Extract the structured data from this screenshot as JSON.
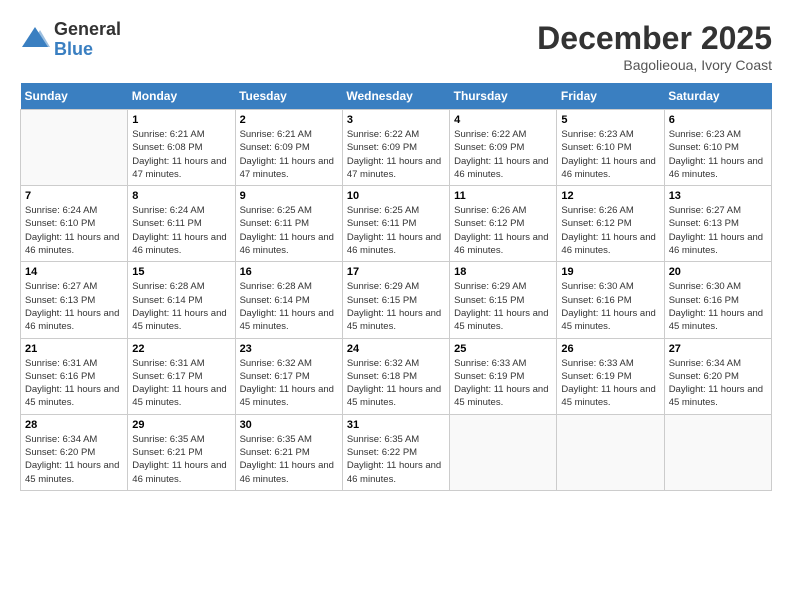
{
  "header": {
    "logo_general": "General",
    "logo_blue": "Blue",
    "month_title": "December 2025",
    "location": "Bagolieoua, Ivory Coast"
  },
  "weekdays": [
    "Sunday",
    "Monday",
    "Tuesday",
    "Wednesday",
    "Thursday",
    "Friday",
    "Saturday"
  ],
  "weeks": [
    [
      {
        "day": "",
        "empty": true
      },
      {
        "day": "1",
        "sunrise": "6:21 AM",
        "sunset": "6:08 PM",
        "daylight": "11 hours and 47 minutes."
      },
      {
        "day": "2",
        "sunrise": "6:21 AM",
        "sunset": "6:09 PM",
        "daylight": "11 hours and 47 minutes."
      },
      {
        "day": "3",
        "sunrise": "6:22 AM",
        "sunset": "6:09 PM",
        "daylight": "11 hours and 47 minutes."
      },
      {
        "day": "4",
        "sunrise": "6:22 AM",
        "sunset": "6:09 PM",
        "daylight": "11 hours and 46 minutes."
      },
      {
        "day": "5",
        "sunrise": "6:23 AM",
        "sunset": "6:10 PM",
        "daylight": "11 hours and 46 minutes."
      },
      {
        "day": "6",
        "sunrise": "6:23 AM",
        "sunset": "6:10 PM",
        "daylight": "11 hours and 46 minutes."
      }
    ],
    [
      {
        "day": "7",
        "sunrise": "6:24 AM",
        "sunset": "6:10 PM",
        "daylight": "11 hours and 46 minutes."
      },
      {
        "day": "8",
        "sunrise": "6:24 AM",
        "sunset": "6:11 PM",
        "daylight": "11 hours and 46 minutes."
      },
      {
        "day": "9",
        "sunrise": "6:25 AM",
        "sunset": "6:11 PM",
        "daylight": "11 hours and 46 minutes."
      },
      {
        "day": "10",
        "sunrise": "6:25 AM",
        "sunset": "6:11 PM",
        "daylight": "11 hours and 46 minutes."
      },
      {
        "day": "11",
        "sunrise": "6:26 AM",
        "sunset": "6:12 PM",
        "daylight": "11 hours and 46 minutes."
      },
      {
        "day": "12",
        "sunrise": "6:26 AM",
        "sunset": "6:12 PM",
        "daylight": "11 hours and 46 minutes."
      },
      {
        "day": "13",
        "sunrise": "6:27 AM",
        "sunset": "6:13 PM",
        "daylight": "11 hours and 46 minutes."
      }
    ],
    [
      {
        "day": "14",
        "sunrise": "6:27 AM",
        "sunset": "6:13 PM",
        "daylight": "11 hours and 46 minutes."
      },
      {
        "day": "15",
        "sunrise": "6:28 AM",
        "sunset": "6:14 PM",
        "daylight": "11 hours and 45 minutes."
      },
      {
        "day": "16",
        "sunrise": "6:28 AM",
        "sunset": "6:14 PM",
        "daylight": "11 hours and 45 minutes."
      },
      {
        "day": "17",
        "sunrise": "6:29 AM",
        "sunset": "6:15 PM",
        "daylight": "11 hours and 45 minutes."
      },
      {
        "day": "18",
        "sunrise": "6:29 AM",
        "sunset": "6:15 PM",
        "daylight": "11 hours and 45 minutes."
      },
      {
        "day": "19",
        "sunrise": "6:30 AM",
        "sunset": "6:16 PM",
        "daylight": "11 hours and 45 minutes."
      },
      {
        "day": "20",
        "sunrise": "6:30 AM",
        "sunset": "6:16 PM",
        "daylight": "11 hours and 45 minutes."
      }
    ],
    [
      {
        "day": "21",
        "sunrise": "6:31 AM",
        "sunset": "6:16 PM",
        "daylight": "11 hours and 45 minutes."
      },
      {
        "day": "22",
        "sunrise": "6:31 AM",
        "sunset": "6:17 PM",
        "daylight": "11 hours and 45 minutes."
      },
      {
        "day": "23",
        "sunrise": "6:32 AM",
        "sunset": "6:17 PM",
        "daylight": "11 hours and 45 minutes."
      },
      {
        "day": "24",
        "sunrise": "6:32 AM",
        "sunset": "6:18 PM",
        "daylight": "11 hours and 45 minutes."
      },
      {
        "day": "25",
        "sunrise": "6:33 AM",
        "sunset": "6:19 PM",
        "daylight": "11 hours and 45 minutes."
      },
      {
        "day": "26",
        "sunrise": "6:33 AM",
        "sunset": "6:19 PM",
        "daylight": "11 hours and 45 minutes."
      },
      {
        "day": "27",
        "sunrise": "6:34 AM",
        "sunset": "6:20 PM",
        "daylight": "11 hours and 45 minutes."
      }
    ],
    [
      {
        "day": "28",
        "sunrise": "6:34 AM",
        "sunset": "6:20 PM",
        "daylight": "11 hours and 45 minutes."
      },
      {
        "day": "29",
        "sunrise": "6:35 AM",
        "sunset": "6:21 PM",
        "daylight": "11 hours and 46 minutes."
      },
      {
        "day": "30",
        "sunrise": "6:35 AM",
        "sunset": "6:21 PM",
        "daylight": "11 hours and 46 minutes."
      },
      {
        "day": "31",
        "sunrise": "6:35 AM",
        "sunset": "6:22 PM",
        "daylight": "11 hours and 46 minutes."
      },
      {
        "day": "",
        "empty": true
      },
      {
        "day": "",
        "empty": true
      },
      {
        "day": "",
        "empty": true
      }
    ]
  ]
}
